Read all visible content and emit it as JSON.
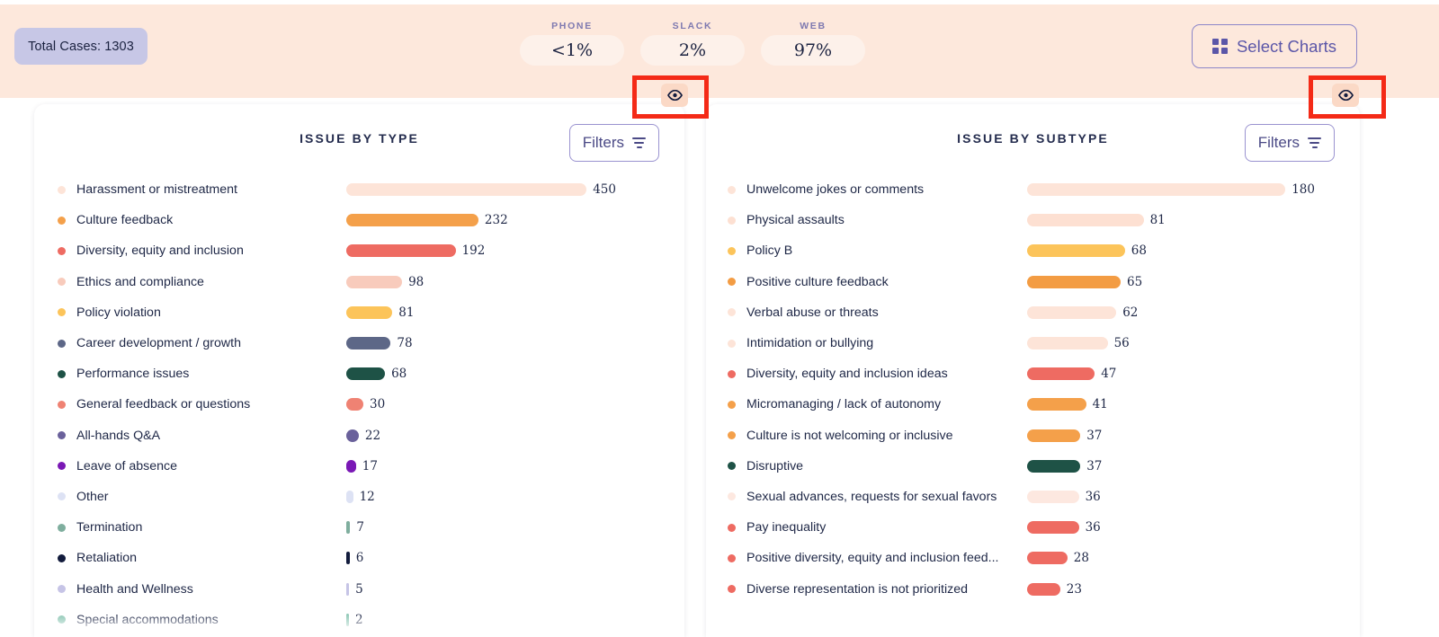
{
  "header": {
    "total_cases_label": "Total Cases: 1303",
    "select_charts_label": "Select Charts",
    "select_charts_icon": "grid-icon",
    "channels": [
      {
        "label": "PHONE",
        "value": "<1%"
      },
      {
        "label": "SLACK",
        "value": "2%"
      },
      {
        "label": "WEB",
        "value": "97%"
      }
    ]
  },
  "toggles": [
    {
      "name": "toggle-visibility-left",
      "icon": "eye-icon",
      "highlighted": true
    },
    {
      "name": "toggle-visibility-right",
      "icon": "eye-icon",
      "highlighted": true
    }
  ],
  "cards": [
    {
      "title": "ISSUE BY TYPE",
      "filters_label": "Filters",
      "filters_icon": "filter-icon"
    },
    {
      "title": "ISSUE BY SUBTYPE",
      "filters_label": "Filters",
      "filters_icon": "filter-icon"
    }
  ],
  "chart_data": [
    {
      "type": "bar",
      "title": "ISSUE BY TYPE",
      "orientation": "horizontal",
      "xlabel": "",
      "ylabel": "",
      "grid": false,
      "legend": "none",
      "xlim": [
        0,
        450
      ],
      "categories": [
        "Harassment or mistreatment",
        "Culture feedback",
        "Diversity, equity and inclusion",
        "Ethics and compliance",
        "Policy violation",
        "Career development / growth",
        "Performance issues",
        "General feedback or questions",
        "All-hands Q&A",
        "Leave of absence",
        "Other",
        "Termination",
        "Retaliation",
        "Health and Wellness",
        "Special accommodations"
      ],
      "values": [
        450,
        232,
        192,
        98,
        81,
        78,
        68,
        30,
        22,
        17,
        12,
        7,
        6,
        5,
        2
      ],
      "colors": [
        "#fde4d8",
        "#f4a04a",
        "#ee6b62",
        "#f8cbbc",
        "#fcc45a",
        "#5d6787",
        "#1e5246",
        "#ef8273",
        "#6a619b",
        "#7a18b5",
        "#dde2f4",
        "#7fae9e",
        "#121b3c",
        "#c6c4e6",
        "#8cc6b4"
      ]
    },
    {
      "type": "bar",
      "title": "ISSUE BY SUBTYPE",
      "orientation": "horizontal",
      "xlabel": "",
      "ylabel": "",
      "grid": false,
      "legend": "none",
      "xlim": [
        0,
        180
      ],
      "categories": [
        "Unwelcome jokes or comments",
        "Physical assaults",
        "Policy B",
        "Positive culture feedback",
        "Verbal abuse or threats",
        "Intimidation or bullying",
        "Diversity, equity and inclusion ideas",
        "Micromanaging / lack of autonomy",
        "Culture is not welcoming or inclusive",
        "Disruptive",
        "Sexual advances, requests for sexual favors",
        "Pay inequality",
        "Positive diversity, equity and inclusion feed...",
        "Diverse representation is not prioritized"
      ],
      "values": [
        180,
        81,
        68,
        65,
        62,
        56,
        47,
        41,
        37,
        37,
        36,
        36,
        28,
        23
      ],
      "colors": [
        "#fde4d8",
        "#fde0d2",
        "#fcc45a",
        "#f39c43",
        "#fde4d8",
        "#fde4d8",
        "#ee6b62",
        "#f4a04a",
        "#f4a04a",
        "#1e5246",
        "#fde8e0",
        "#ee6b62",
        "#ee6b62",
        "#ee6b62"
      ]
    }
  ],
  "palette": {
    "band_background": "#fde8dc",
    "badge_background": "#c7c7e6",
    "accent_purple": "#5b56a8",
    "annotation_red": "#f42a17",
    "text_dark": "#1e2746"
  }
}
